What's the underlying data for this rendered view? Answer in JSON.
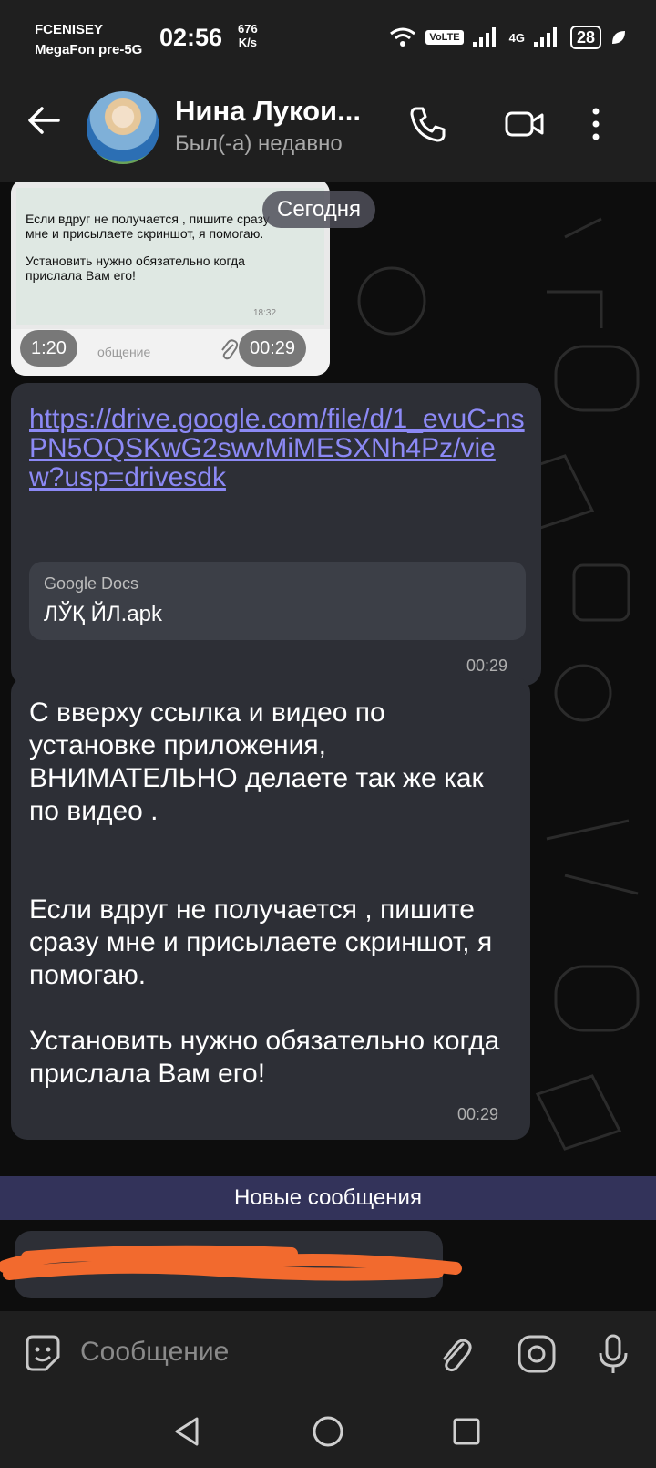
{
  "status_bar": {
    "carrier1": "FCENISEY",
    "carrier2": "MegaFon pre-5G",
    "time": "02:56",
    "speed_value": "676",
    "speed_unit": "K/s",
    "volte": "VoLTE",
    "network": "4G",
    "battery": "28"
  },
  "header": {
    "contact_name": "Нина Лукои...",
    "contact_status": "Был(-а) недавно"
  },
  "chat": {
    "date_pill": "Сегодня",
    "video_message": {
      "line1": "Если вдруг не получается , пишите сразу мне и присылаете скриншот, я помогаю.",
      "line2": "Установить нужно обязательно когда прислала Вам его!",
      "inner_time": "18:32",
      "placeholder": "общение",
      "duration": "1:20",
      "time": "00:29"
    },
    "link_message": {
      "url": "https://drive.google.com/file/d/1_evuC-nsPN5OQSKwG2swvMiMESXNh4Pz/view?usp=drivesdk",
      "preview_source": "Google Docs",
      "preview_title": "ЛЎҚ ЙЛ.apk",
      "time": "00:29"
    },
    "text_message": {
      "p1": "С вверху ссылка и видео по установке приложения, ВНИМАТЕЛЬНО делаете так же как по видео .",
      "p2": "Если вдруг не получается , пишите сразу мне и присылаете скриншот, я помогаю.",
      "p3": "Установить нужно обязательно когда прислала Вам его!",
      "time": "00:29"
    },
    "new_messages_label": "Новые сообщения"
  },
  "input": {
    "placeholder": "Сообщение"
  },
  "colors": {
    "bar_bg": "#1f1f1f",
    "bubble_bg": "#2d2f36",
    "link": "#8c89f5",
    "new_messages_bg": "#33335a",
    "scribble": "#f26a2e"
  }
}
